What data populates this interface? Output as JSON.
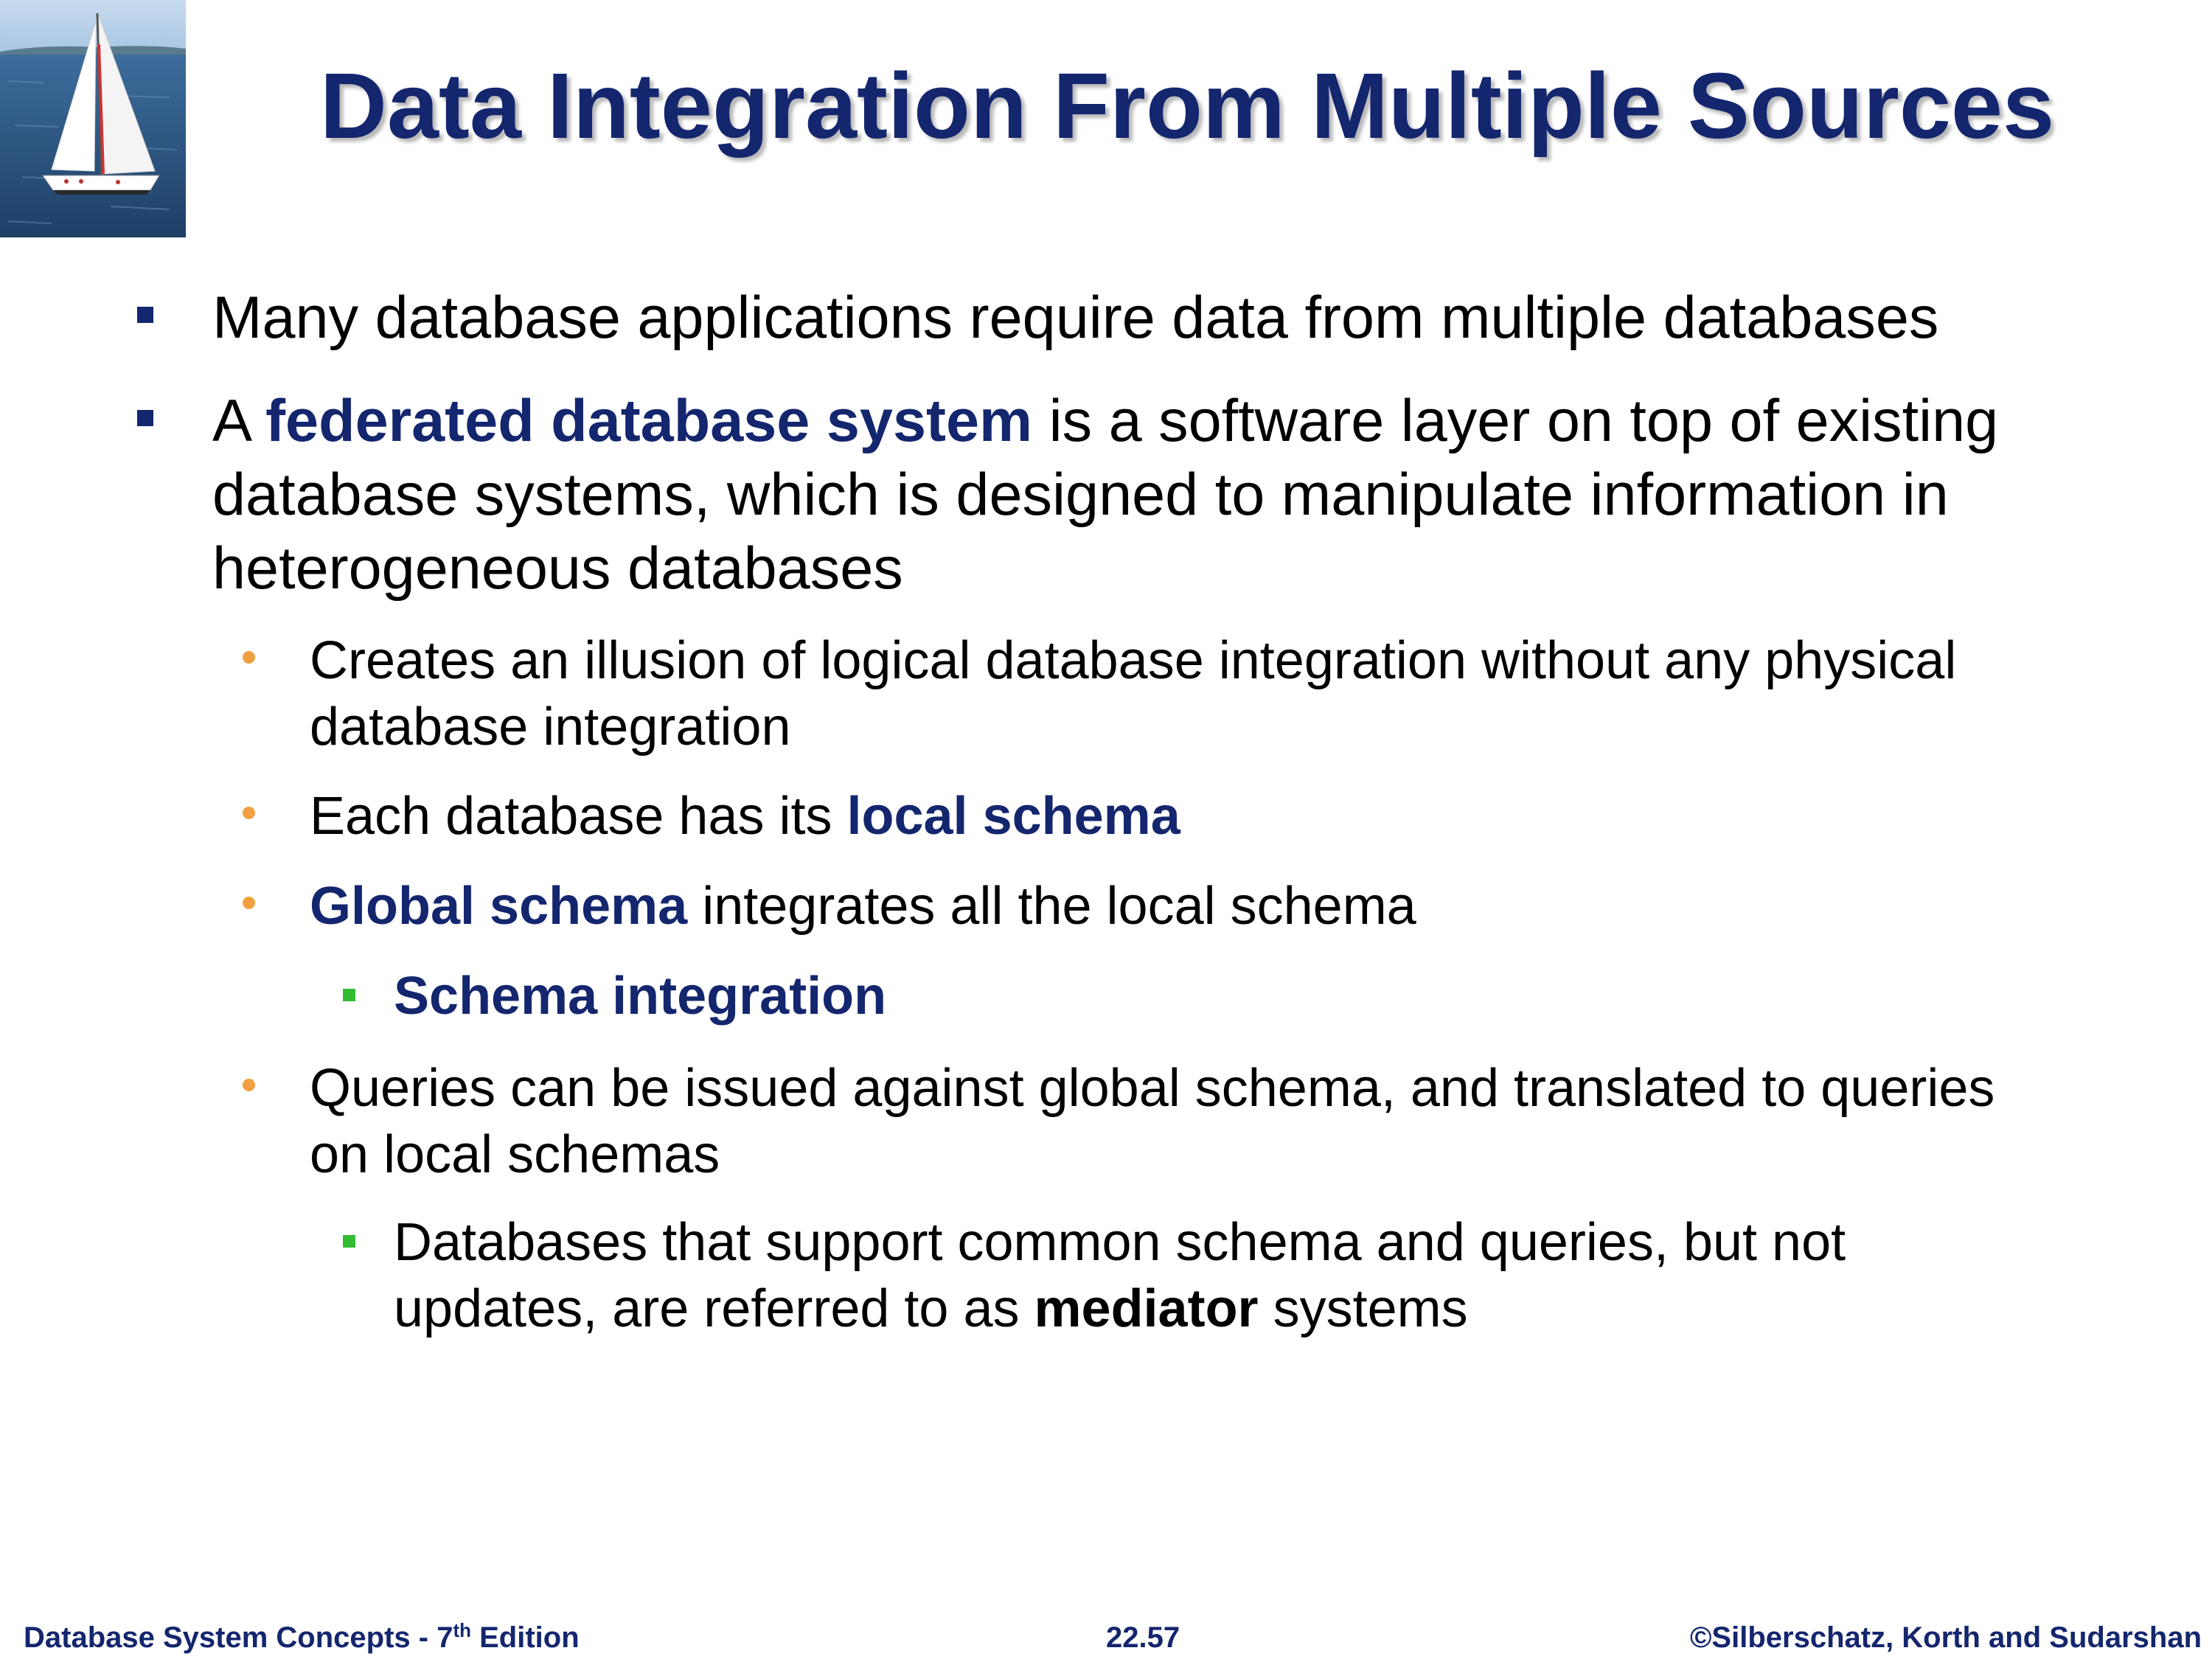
{
  "title": "Data Integration From Multiple Sources",
  "logo": {
    "icon": "sailboat-photo"
  },
  "colors": {
    "title": "#14266e",
    "keyword": "#14266e",
    "bullet_level1": "#14266e",
    "bullet_level2": "#f0a040",
    "bullet_level3": "#33bb33"
  },
  "bullets": {
    "b1": "Many database applications require data from multiple databases",
    "b2": {
      "pre": "A ",
      "term": "federated database system",
      "line1_post": " is a software layer on top of existing",
      "line2": "database systems, which is designed to manipulate information in",
      "line3": "heterogeneous databases"
    },
    "b2_1": {
      "line1": "Creates an illusion of logical database integration without any physical",
      "line2": "database integration"
    },
    "b2_2": {
      "pre": "Each database has its ",
      "term": "local schema"
    },
    "b2_3": {
      "term": "Global schema",
      "post": " integrates all the local schema"
    },
    "b2_3_1": {
      "term": "Schema integration"
    },
    "b2_4": {
      "line1": "Queries can be issued against global schema, and translated to queries",
      "line2": "on local schemas"
    },
    "b2_4_1": {
      "line1": "Databases that support common schema and queries, but not",
      "line2_pre": "updates, are referred to as ",
      "term": "mediator",
      "line2_post": " systems"
    }
  },
  "footer": {
    "left_pre": "Database System Concepts - 7",
    "left_sup": "th",
    "left_post": " Edition",
    "center": "22.57",
    "right": "©Silberschatz, Korth and Sudarshan"
  }
}
